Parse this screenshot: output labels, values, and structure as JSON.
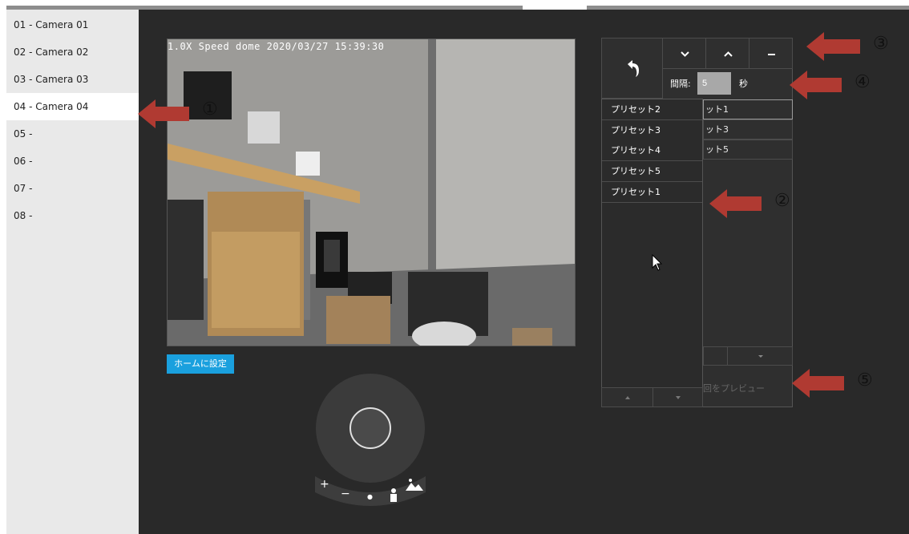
{
  "cameras": [
    {
      "label": "01 - Camera 01"
    },
    {
      "label": "02 - Camera 02"
    },
    {
      "label": "03 - Camera 03"
    },
    {
      "label": "04 - Camera 04"
    },
    {
      "label": "05 -"
    },
    {
      "label": "06 -"
    },
    {
      "label": "07 -"
    },
    {
      "label": "08 -"
    }
  ],
  "selected_camera_index": 3,
  "video": {
    "osd_text": "1.0X Speed dome 2020/03/27 15:39:30"
  },
  "home_button": "ホームに設定",
  "zoom": {
    "plus": "+",
    "minus": "−",
    "dot": "●"
  },
  "panel": {
    "interval_label": "間隔:",
    "interval_value": "5",
    "interval_unit": "秒",
    "right_items": [
      "ット1",
      "ット3",
      "ット5"
    ],
    "preview_label": "回をプレビュー"
  },
  "dropdown": {
    "items": [
      "プリセット2",
      "プリセット3",
      "プリセット4",
      "プリセット5",
      "プリセット1"
    ]
  },
  "annotations": [
    "①",
    "②",
    "③",
    "④",
    "⑤"
  ],
  "colors": {
    "accent": "#1aa0de",
    "arrow": "#b03a32",
    "dark_bg": "#292929"
  }
}
